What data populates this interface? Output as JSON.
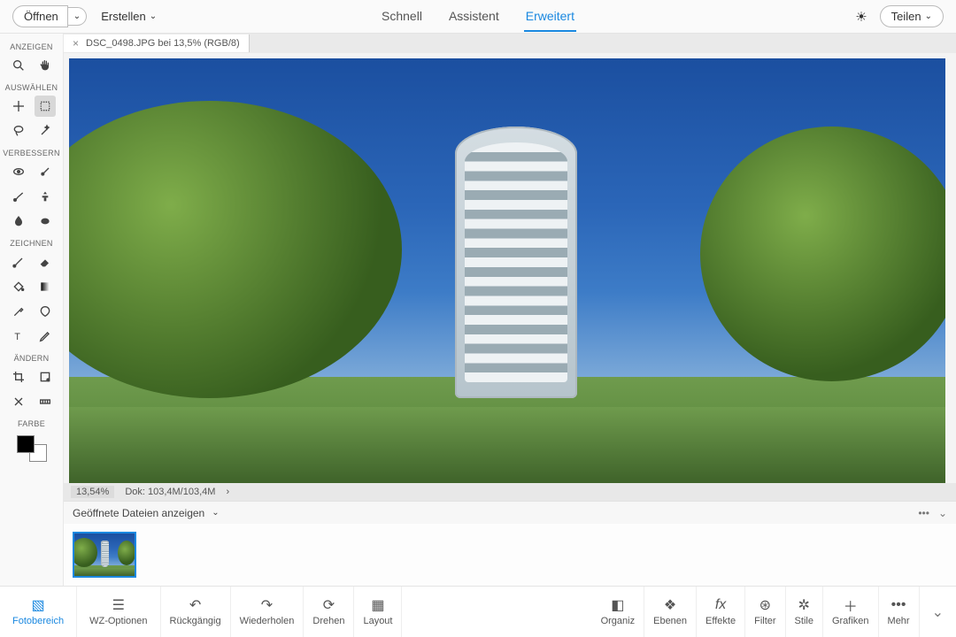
{
  "topbar": {
    "open": "Öffnen",
    "create": "Erstellen",
    "share": "Teilen"
  },
  "modes": {
    "quick": "Schnell",
    "guided": "Assistent",
    "expert": "Erweitert"
  },
  "doc_tab": "DSC_0498.JPG bei 13,5% (RGB/8)",
  "status": {
    "zoom": "13,54%",
    "doc": "Dok: 103,4M/103,4M"
  },
  "open_files": "Geöffnete Dateien anzeigen",
  "tool_sections": {
    "anzeigen": "ANZEIGEN",
    "auswaehlen": "AUSWÄHLEN",
    "verbessern": "VERBESSERN",
    "zeichnen": "ZEICHNEN",
    "aendern": "ÄNDERN",
    "farbe": "FARBE"
  },
  "bottom": {
    "fotobereich": "Fotobereich",
    "wzoptionen": "WZ-Optionen",
    "undo": "Rückgängig",
    "redo": "Wiederholen",
    "drehen": "Drehen",
    "layout": "Layout",
    "organiz": "Organiz",
    "ebenen": "Ebenen",
    "effekte": "Effekte",
    "filter": "Filter",
    "stile": "Stile",
    "grafiken": "Grafiken",
    "mehr": "Mehr"
  }
}
